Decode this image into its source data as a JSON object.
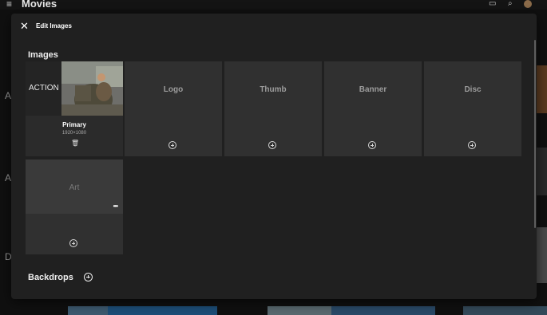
{
  "app": {
    "menu_icon": "hamburger-icon",
    "title": "Movies",
    "toolbar_icons": [
      "cast-icon",
      "search-icon",
      "avatar"
    ]
  },
  "background": {
    "row_letters": [
      "A",
      "A",
      "D"
    ]
  },
  "dialog": {
    "close_icon": "close-icon",
    "title": "Edit Images",
    "images_section": {
      "title": "Images",
      "primary": {
        "label": "Primary",
        "resolution": "1920×1080",
        "poster_text": "ACTION",
        "delete_icon": "trash-icon"
      },
      "cards": [
        {
          "label": "Logo"
        },
        {
          "label": "Thumb"
        },
        {
          "label": "Banner"
        },
        {
          "label": "Disc"
        },
        {
          "label": "Art"
        }
      ],
      "add_icon": "add-circle-icon",
      "more_icon": "more-horiz-icon"
    },
    "backdrops_section": {
      "title": "Backdrops",
      "add_icon": "add-circle-icon"
    }
  },
  "colors": {
    "dialog_bg": "#202020",
    "card_bg": "#303030",
    "art_card_top": "#3a3a3a"
  }
}
